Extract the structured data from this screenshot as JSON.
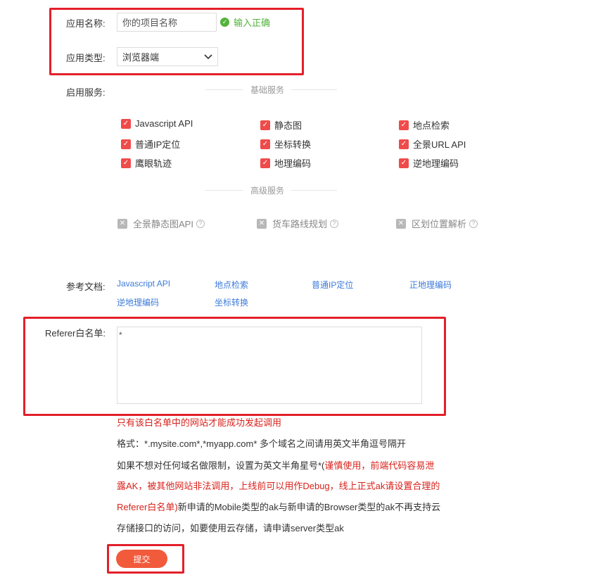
{
  "form": {
    "app_name_label": "应用名称:",
    "app_name_value": "你的项目名称",
    "app_name_status": "输入正确",
    "app_type_label": "应用类型:",
    "app_type_value": "浏览器端",
    "services_label": "启用服务:",
    "basic_services_title": "基础服务",
    "advanced_services_title": "高级服务",
    "basic_services": [
      "Javascript API",
      "静态图",
      "地点检索",
      "普通IP定位",
      "坐标转换",
      "全景URL API",
      "鹰眼轨迹",
      "地理编码",
      "逆地理编码"
    ],
    "advanced_services": [
      "全景静态图API",
      "货车路线规划",
      "区划位置解析"
    ],
    "docs_label": "参考文档:",
    "docs": [
      "Javascript API",
      "地点检索",
      "普通IP定位",
      "正地理编码",
      "逆地理编码",
      "坐标转换"
    ],
    "referer_label": "Referer白名单:",
    "referer_value": "*",
    "notes": {
      "line1": "只有该白名单中的网站才能成功发起调用",
      "line2": "格式：*.mysite.com*,*myapp.com* 多个域名之间请用英文半角逗号隔开",
      "line3_a": "如果不想对任何域名做限制，设置为英文半角星号*(",
      "line3_b": "谨慎使用，前端代码容易泄",
      "line4": "露AK，被其他网站非法调用，上线前可以用作Debug，线上正式ak请设置合理的",
      "line5_a": "Referer白名单)",
      "line5_b": "新申请的Mobile类型的ak与新申请的Browser类型的ak不再支持云",
      "line6": "存储接口的访问，如要使用云存储，请申请server类型ak"
    },
    "submit_label": "提交"
  },
  "colors": {
    "accent": "#ef4b4b",
    "ok": "#52b33a",
    "link": "#3d7bd9",
    "highlight_box": "#e3202a"
  }
}
